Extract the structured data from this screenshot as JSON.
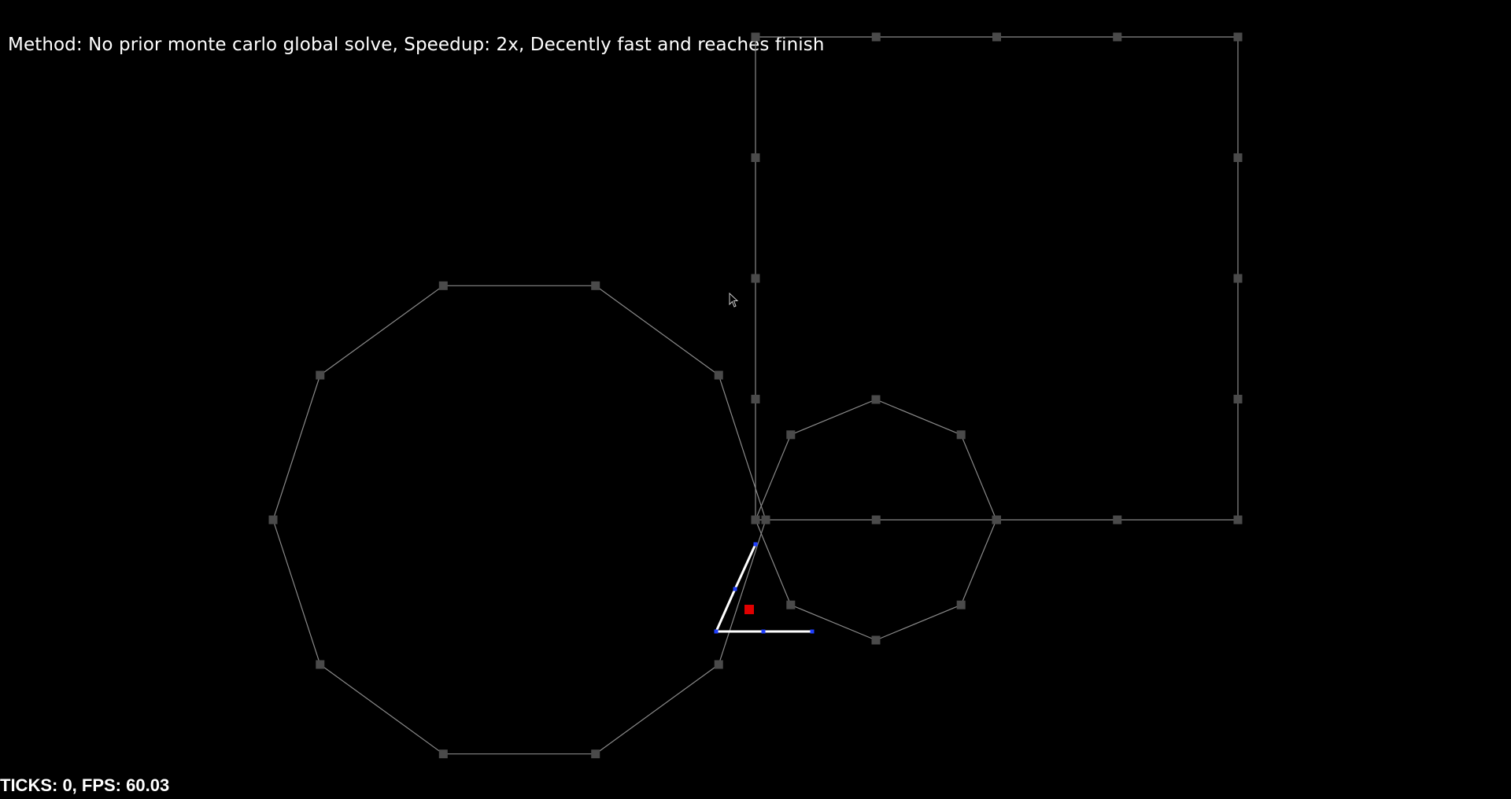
{
  "status": {
    "method_line": "Method: No prior monte carlo global solve, Speedup: 2x, Decently fast and reaches finish",
    "ticks_fps": "TICKS: 0, FPS: 60.03"
  },
  "colors": {
    "background": "#000000",
    "edge": "#8a8a8a",
    "node": "#4a4a4a",
    "path": "#ffffff",
    "path_node": "#1f3fff",
    "goal": "#e00000"
  },
  "shapes": {
    "decagon_vertices": 10,
    "octagon_vertices": 8,
    "square_nodes_per_side": 5
  },
  "icons": {
    "cursor": "mouse-pointer-icon",
    "goal": "goal-marker-icon"
  }
}
